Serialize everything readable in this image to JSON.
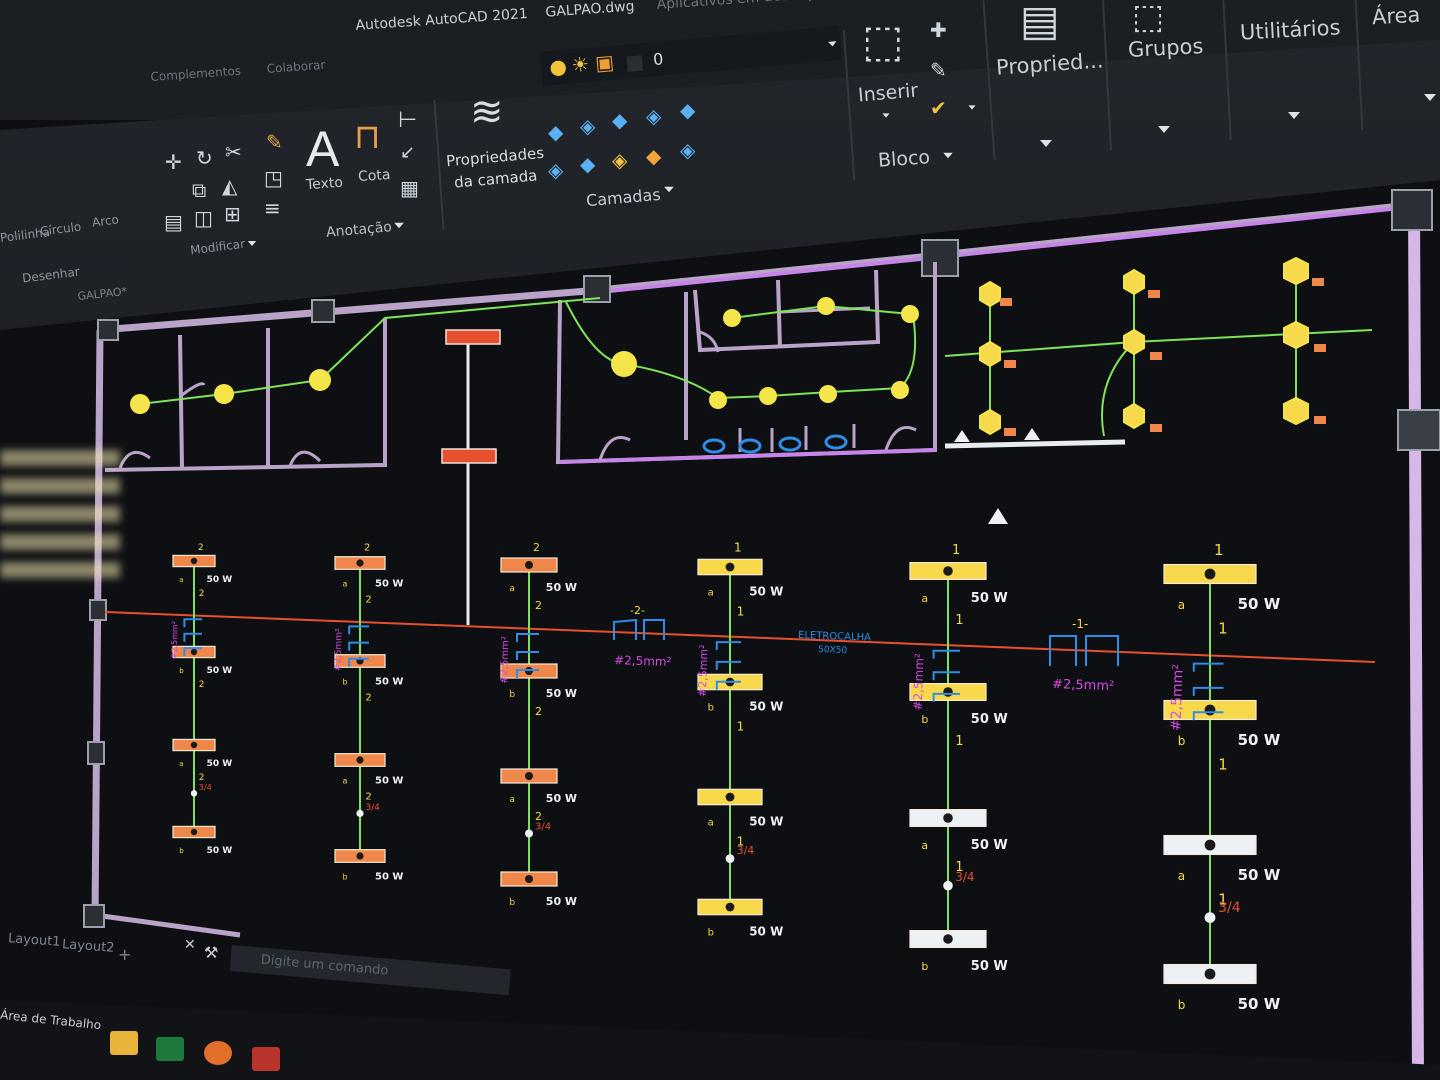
{
  "window": {
    "app_title": "Autodesk AutoCAD 2021",
    "file_name": "GALPAO.dwg",
    "search_hint": "Aplicativos em destaque",
    "menu_tabs": [
      "Complementos",
      "Colaborar"
    ]
  },
  "ribbon": {
    "draw_group": {
      "label": "Desenhar",
      "tools": [
        "Polilinha",
        "Círculo",
        "Arco"
      ]
    },
    "modify_group": {
      "label": "Modificar"
    },
    "annotation_group": {
      "label": "Anotação",
      "text_tool": "Texto",
      "dim_tool": "Cota",
      "letter": "A"
    },
    "layer_props": {
      "line1": "Propriedades",
      "line2": "da camada"
    },
    "layers_group": {
      "label": "Camadas",
      "current_layer": "0"
    },
    "block_group": {
      "label": "Bloco",
      "insert_tool": "Inserir"
    },
    "properties_tool": "Propried...",
    "groups_tool": "Grupos",
    "utilities_tool": "Utilitários",
    "clipboard_tool": "Área"
  },
  "drawing": {
    "file_tab": "GALPAO*",
    "tray_label": "ELETROCALHA",
    "tray_size": "50X50",
    "cable_labels": [
      "#2,5mm²",
      "#2,5mm²"
    ],
    "circuit_marks": [
      "-2-",
      "-1-"
    ],
    "power_label": "50 W",
    "circuit_numbers": [
      "1",
      "2",
      "a",
      "b"
    ],
    "switch_label": "3/4",
    "vertical_cable_label": "#2,5mm²"
  },
  "layout_tabs": [
    "Layout1",
    "Layout2"
  ],
  "command_line": {
    "placeholder": "Digite um comando"
  },
  "taskbar": {
    "label": "Área de Trabalho"
  },
  "colors": {
    "ribbon_bg": "#1d2126",
    "canvas_bg": "#0d0f13",
    "wall": "#b9a3c9",
    "wall_accent": "#c784e8",
    "wire_green": "#7fe35a",
    "lamp_yellow": "#f4e64a",
    "fixture_orange": "#f0874a",
    "fixture_yellow": "#f7d94b",
    "tray_red": "#e6502f",
    "cable_blue": "#2f8de8",
    "label_magenta": "#d44be2"
  }
}
